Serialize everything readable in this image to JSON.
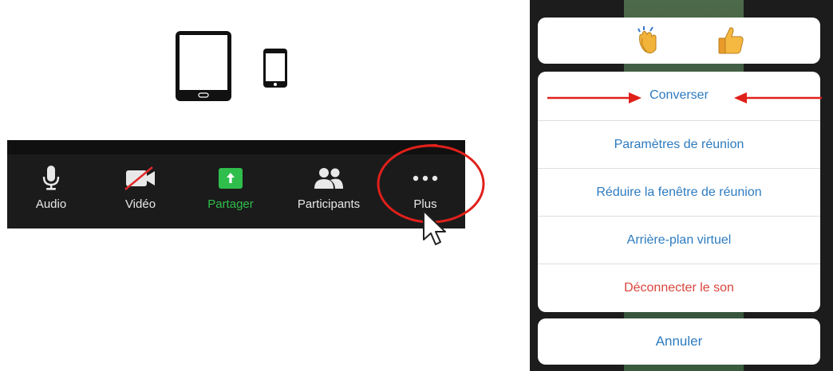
{
  "toolbar": {
    "items": [
      {
        "label": "Audio",
        "icon": "microphone-icon"
      },
      {
        "label": "Vidéo",
        "icon": "video-off-icon"
      },
      {
        "label": "Partager",
        "icon": "share-up-arrow-icon"
      },
      {
        "label": "Participants",
        "icon": "participants-icon"
      },
      {
        "label": "Plus",
        "icon": "more-dots-icon"
      }
    ]
  },
  "menu": {
    "reactions": [
      "clapping-hands-icon",
      "thumbs-up-icon"
    ],
    "items": [
      {
        "label": "Converser"
      },
      {
        "label": "Paramètres de réunion"
      },
      {
        "label": "Réduire la fenêtre de réunion"
      },
      {
        "label": "Arrière-plan virtuel"
      },
      {
        "label": "Déconnecter le son"
      }
    ],
    "cancel": "Annuler"
  },
  "colors": {
    "toolbar_bg": "#1b1b1b",
    "share_green": "#2fbe4c",
    "menu_text": "#2d7bbf",
    "danger_text": "#d9453d",
    "annotation_red": "#e0201b"
  }
}
